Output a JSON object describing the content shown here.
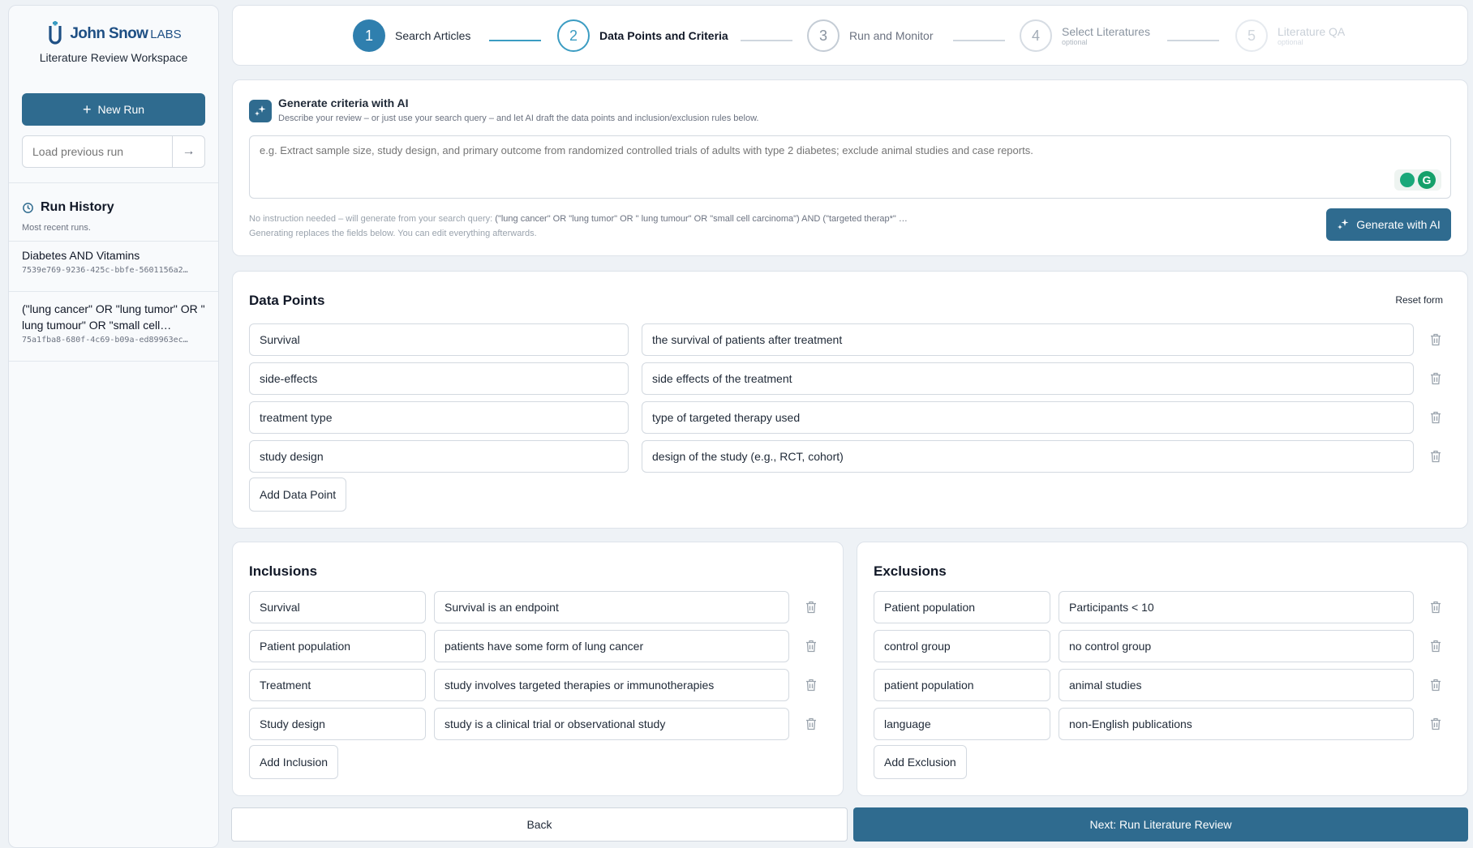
{
  "sidebar": {
    "logo_brand": "John Snow",
    "logo_suffix": "LABS",
    "workspace_title": "Literature Review Workspace",
    "new_run_label": "New Run",
    "load_placeholder": "Load previous run",
    "history_title": "Run History",
    "history_subtitle": "Most recent runs.",
    "history": [
      {
        "query": "Diabetes AND Vitamins",
        "id": "7539e769-9236-425c-bbfe-5601156a2…"
      },
      {
        "query": "(\"lung cancer\" OR \"lung tumor\" OR \" lung tumour\" OR \"small cell…",
        "id": "75a1fba8-680f-4c69-b09a-ed89963ec…"
      }
    ]
  },
  "stepper": {
    "steps": [
      {
        "num": "1",
        "label": "Search Articles",
        "sub": "",
        "state": "done"
      },
      {
        "num": "2",
        "label": "Data Points and Criteria",
        "sub": "",
        "state": "active"
      },
      {
        "num": "3",
        "label": "Run and Monitor",
        "sub": "",
        "state": "pending"
      },
      {
        "num": "4",
        "label": "Select Literatures",
        "sub": "optional",
        "state": "faded"
      },
      {
        "num": "5",
        "label": "Literature QA",
        "sub": "optional",
        "state": "faded2"
      }
    ]
  },
  "generate": {
    "title": "Generate criteria with AI",
    "description": "Describe your review – or just use your search query – and let AI draft the data points and inclusion/exclusion rules below.",
    "placeholder": "e.g. Extract sample size, study design, and primary outcome from randomized controlled trials of adults with type 2 diabetes; exclude animal studies and case reports.",
    "note_prefix": "No instruction needed – will generate from your search query:",
    "note_query": "(\"lung cancer\" OR \"lung tumor\" OR \" lung tumour\" OR \"small cell carcinoma\") AND (\"targeted therap*\" …",
    "note_line2": "Generating replaces the fields below. You can edit everything afterwards.",
    "button_label": "Generate with AI"
  },
  "data_points": {
    "title": "Data Points",
    "reset_label": "Reset form",
    "rows": [
      {
        "name": "Survival",
        "description": "the survival of patients after treatment"
      },
      {
        "name": "side-effects",
        "description": "side effects of the treatment"
      },
      {
        "name": "treatment type",
        "description": "type of targeted therapy used"
      },
      {
        "name": "study design",
        "description": "design of the study (e.g., RCT, cohort)"
      }
    ],
    "add_label": "Add Data Point"
  },
  "inclusions": {
    "title": "Inclusions",
    "rows": [
      {
        "name": "Survival",
        "rule": "Survival is an endpoint"
      },
      {
        "name": "Patient population",
        "rule": "patients have some form of lung cancer"
      },
      {
        "name": "Treatment",
        "rule": "study involves targeted therapies or immunotherapies"
      },
      {
        "name": "Study design",
        "rule": "study is a clinical trial or observational study"
      }
    ],
    "add_label": "Add Inclusion"
  },
  "exclusions": {
    "title": "Exclusions",
    "rows": [
      {
        "name": "Patient population",
        "rule": "Participants < 10"
      },
      {
        "name": "control group",
        "rule": "no control group"
      },
      {
        "name": "patient population",
        "rule": "animal studies"
      },
      {
        "name": "language",
        "rule": "non-English publications"
      }
    ],
    "add_label": "Add Exclusion"
  },
  "footer": {
    "back_label": "Back",
    "next_label": "Next: Run Literature Review"
  },
  "colors": {
    "primary": "#2f6b8f",
    "accent": "#3b9cc2"
  }
}
